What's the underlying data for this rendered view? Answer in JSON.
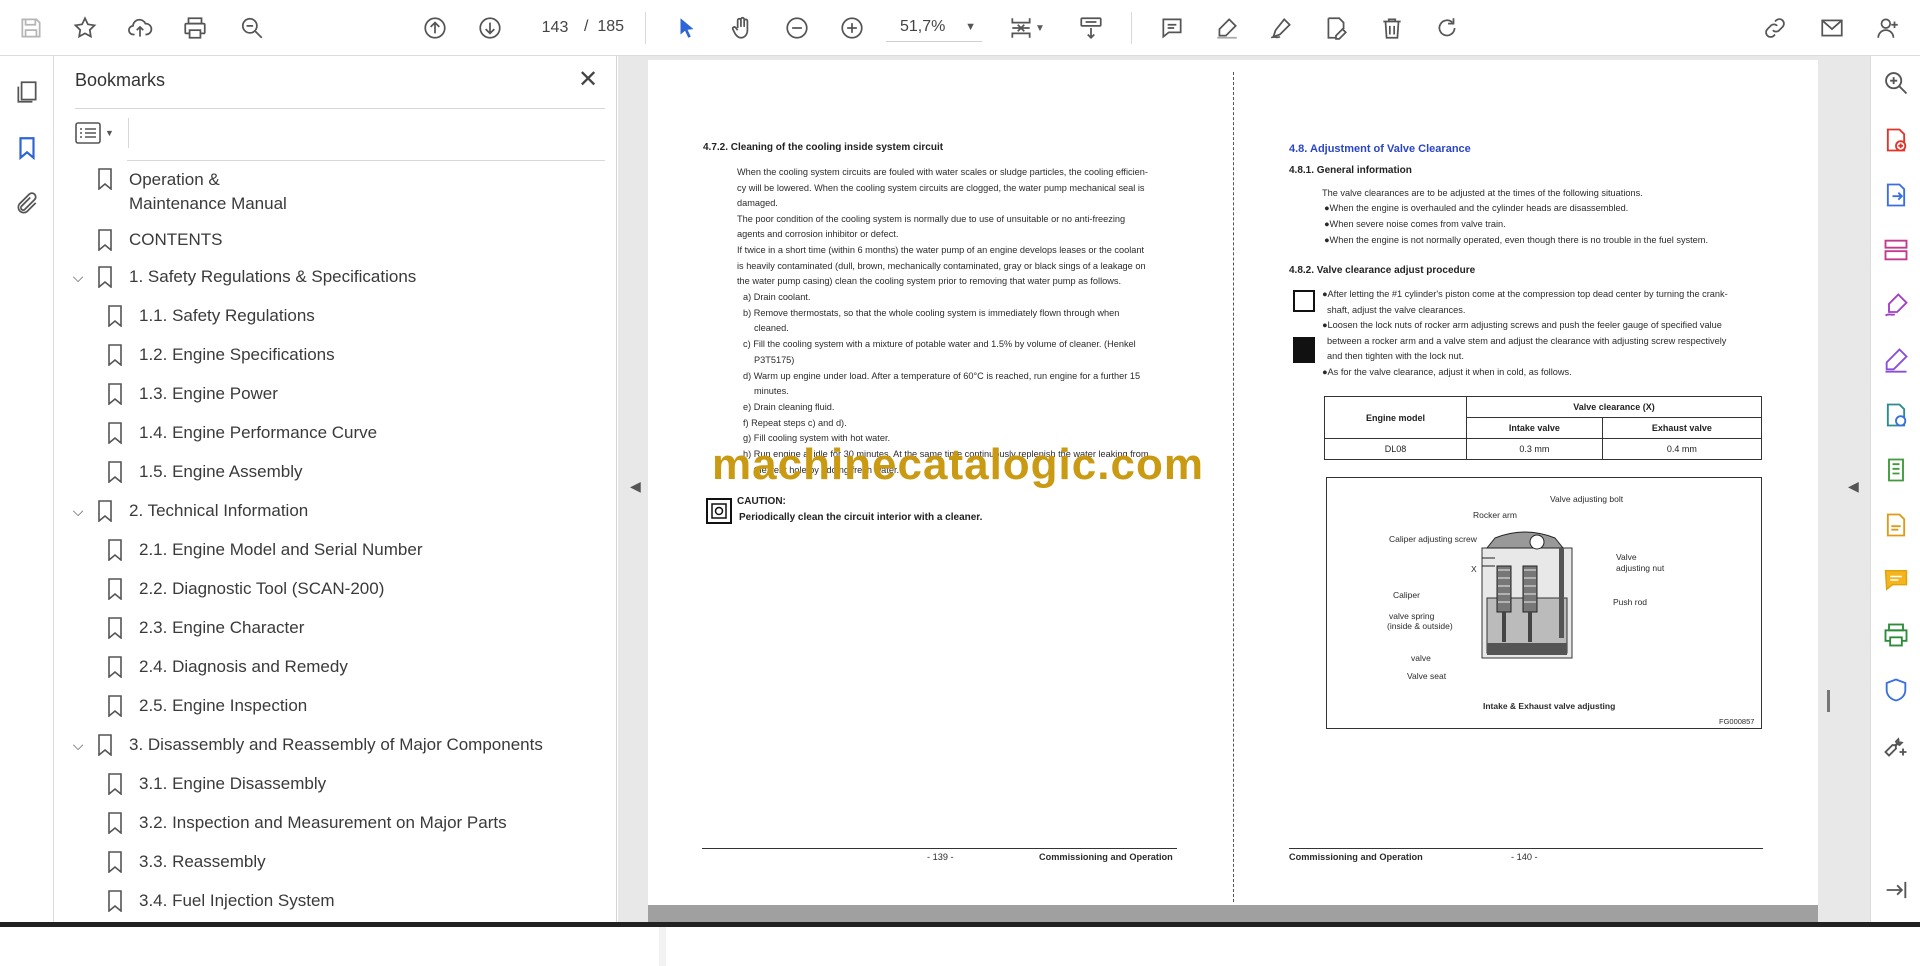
{
  "toolbar": {
    "icons": [
      "save-icon",
      "star-icon",
      "upload-icon",
      "print-icon",
      "zoom-search-icon",
      "page-up-icon",
      "page-down-icon",
      "select-arrow-icon",
      "hand-icon",
      "zoom-out-icon",
      "zoom-in-icon",
      "fit-page-icon",
      "scroll-mode-icon",
      "comment-icon",
      "highlight-icon",
      "sign-icon",
      "edit-icon",
      "delete-icon",
      "rotate-icon",
      "share-link-icon",
      "mail-icon",
      "account-icon"
    ],
    "current_page": "143",
    "page_separator": "/",
    "total_pages": "185",
    "zoom": "51,7%"
  },
  "left_rail": {
    "icons": [
      "pages-icon",
      "bookmark-icon",
      "attachment-icon"
    ]
  },
  "bookmarks": {
    "title": "Bookmarks",
    "close": "✕",
    "items": [
      {
        "label": "Operation &",
        "label2": "Maintenance Manual",
        "level": 0,
        "expandable": false
      },
      {
        "label": "CONTENTS",
        "level": 0,
        "expandable": false
      },
      {
        "label": "1. Safety Regulations & Specifications",
        "level": 0,
        "expandable": true
      },
      {
        "label": "1.1. Safety Regulations",
        "level": 1
      },
      {
        "label": "1.2. Engine Specifications",
        "level": 1
      },
      {
        "label": "1.3. Engine Power",
        "level": 1
      },
      {
        "label": "1.4. Engine Performance Curve",
        "level": 1
      },
      {
        "label": "1.5. Engine Assembly",
        "level": 1
      },
      {
        "label": "2. Technical Information",
        "level": 0,
        "expandable": true
      },
      {
        "label": "2.1. Engine Model and Serial Number",
        "level": 1
      },
      {
        "label": "2.2. Diagnostic Tool (SCAN-200)",
        "level": 1
      },
      {
        "label": "2.3. Engine Character",
        "level": 1
      },
      {
        "label": "2.4. Diagnosis and Remedy",
        "level": 1
      },
      {
        "label": "2.5. Engine Inspection",
        "level": 1
      },
      {
        "label": "3. Disassembly and Reassembly of Major Components",
        "level": 0,
        "expandable": true
      },
      {
        "label": "3.1. Engine Disassembly",
        "level": 1
      },
      {
        "label": "3.2. Inspection and Measurement on Major Parts",
        "level": 1
      },
      {
        "label": "3.3. Reassembly",
        "level": 1
      },
      {
        "label": "3.4. Fuel Injection System",
        "level": 1
      }
    ]
  },
  "left_page": {
    "heading": "4.7.2. Cleaning of the cooling inside system circuit",
    "lines": [
      "When the cooling system circuits are fouled with water scales or sludge particles, the cooling efficien-",
      "cy will be lowered. When the cooling system circuits are clogged, the water pump mechanical seal is",
      "damaged.",
      "The poor condition of the cooling system is normally due to use of unsuitable or no anti-freezing",
      "agents and corrosion inhibitor or defect.",
      "If twice in a short time (within 6 months) the water pump of an engine develops leases or the coolant",
      "is heavily contaminated (dull, brown, mechanically contaminated, gray or black sings of a leakage on",
      "the water pump casing) clean the cooling system prior to removing that water pump as follows."
    ],
    "steps": [
      "a) Drain coolant.",
      "b) Remove thermostats, so that the whole cooling system is immediately flown through when",
      "cleaned.",
      "c) Fill the cooling system with a mixture of potable water and 1.5% by volume of cleaner. (Henkel",
      "P3T5175)",
      "d) Warm up engine under load. After a temperature of 60°C is reached, run engine for a further 15",
      "minutes.",
      "e) Drain cleaning fluid.",
      "f) Repeat steps c) and d).",
      "g) Fill cooling system with hot water.",
      "h) Run engine at idle for 30 minutes. At the same time continuously replenish the water leaking from",
      "the vent hole by adding fresh water."
    ],
    "caution_title": "CAUTION:",
    "caution_text": "Periodically clean the circuit interior with a cleaner.",
    "footer_page": "- 139 -",
    "footer_section": "Commissioning and Operation"
  },
  "right_page": {
    "title": "4.8. Adjustment of Valve Clearance",
    "sub1": "4.8.1. General information",
    "intro": "The valve clearances are to be adjusted at the times of the following situations.",
    "bullets": [
      "●When the engine is overhauled and the cylinder heads are disassembled.",
      "●When severe noise comes from valve train.",
      "●When the engine is not normally operated, even though there is no trouble in the fuel system."
    ],
    "sub2": "4.8.2. Valve clearance adjust procedure",
    "proc": [
      "●After letting the #1 cylinder's piston come at the compression top dead center by turning the crank-",
      "shaft, adjust the valve clearances.",
      "●Loosen the lock nuts of rocker arm adjusting screws and push the feeler gauge of specified value",
      "between a rocker arm and a valve stem and adjust the clearance with adjusting screw respectively",
      "and then tighten with the lock nut.",
      "●As for the valve clearance, adjust it when in cold, as follows."
    ],
    "table": {
      "col_model": "Engine model",
      "col_group": "Valve clearance (X)",
      "col_intake": "Intake valve",
      "col_exhaust": "Exhaust valve",
      "row_model": "DL08",
      "row_intake": "0.3 mm",
      "row_exhaust": "0.4 mm"
    },
    "figure": {
      "labels": [
        "Valve adjusting bolt",
        "Rocker arm",
        "Caliper adjusting screw",
        "Valve",
        "adjusting nut",
        "X",
        "Caliper",
        "Push rod",
        "valve spring",
        "(inside & outside)",
        "valve",
        "Valve seat"
      ],
      "caption": "Intake & Exhaust valve adjusting",
      "code": "FG000857"
    },
    "footer_section": "Commissioning and Operation",
    "footer_page": "- 140 -"
  },
  "watermark": "machinecatalogic.com",
  "right_rail": {
    "icons": [
      "zoom-icon",
      "create-pdf-icon",
      "export-pdf-icon",
      "organize-pages-icon",
      "fill-sign-icon",
      "edit-pdf-icon",
      "combine-icon",
      "compress-icon",
      "scan-icon",
      "comment-icon",
      "print-production-icon",
      "protect-icon",
      "more-tools-icon",
      "expand-panel-icon"
    ]
  }
}
